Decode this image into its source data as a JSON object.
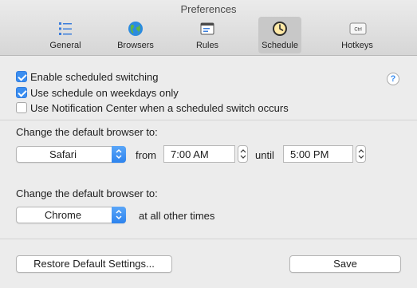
{
  "window": {
    "title": "Preferences"
  },
  "toolbar": {
    "tabs": [
      {
        "label": "General",
        "icon": "list-icon"
      },
      {
        "label": "Browsers",
        "icon": "globe-icon"
      },
      {
        "label": "Rules",
        "icon": "rules-icon"
      },
      {
        "label": "Schedule",
        "icon": "clock-icon",
        "selected": true
      },
      {
        "label": "Hotkeys",
        "icon": "ctrl-key-icon",
        "icon_text": "Ctrl"
      }
    ]
  },
  "options": {
    "enable_switching": {
      "label": "Enable scheduled switching",
      "checked": true
    },
    "weekdays_only": {
      "label": "Use schedule on weekdays only",
      "checked": true
    },
    "notification_center": {
      "label": "Use Notification Center when a scheduled switch occurs",
      "checked": false
    },
    "help_label": "?"
  },
  "schedule": {
    "heading": "Change the default browser to:",
    "browser": "Safari",
    "from_label": "from",
    "from_time": "7:00 AM",
    "until_label": "until",
    "until_time": "5:00 PM"
  },
  "other_times": {
    "heading": "Change the default browser to:",
    "browser": "Chrome",
    "suffix": "at all other times"
  },
  "footer": {
    "restore_label": "Restore Default Settings...",
    "save_label": "Save"
  },
  "colors": {
    "accent": "#3b8ef0",
    "selected_tab": "#c8c8c8"
  }
}
